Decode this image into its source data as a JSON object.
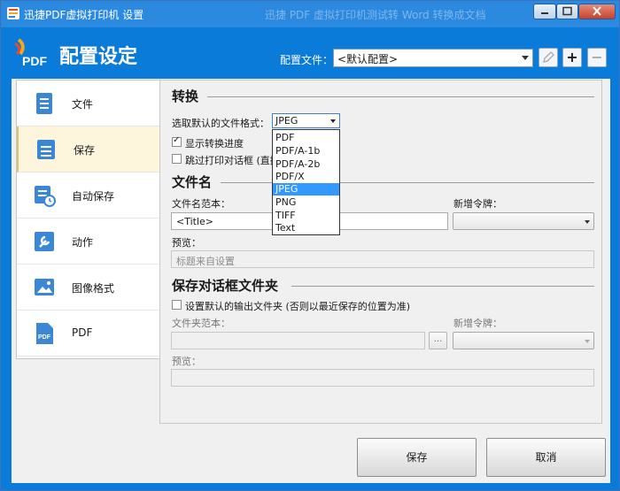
{
  "window": {
    "title": "迅捷PDF虚拟打印机 设置",
    "ghost_title": "迅捷 PDF 虚拟打印机测试转 Word 转换成文档",
    "colors": {
      "header": "#0a7bd8",
      "selection": "#3399ff",
      "nav_active": "#fdf5dc"
    }
  },
  "header": {
    "logo_text": "PDF",
    "title": "配置设定",
    "profile_label": "配置文件：",
    "profile_value": "<默认配置>",
    "icons": [
      "pencil-icon",
      "plus-icon",
      "minus-icon"
    ],
    "plus_glyph": "+",
    "minus_glyph": "−"
  },
  "nav": {
    "items": [
      {
        "label": "文件",
        "icon": "document-icon"
      },
      {
        "label": "保存",
        "icon": "save-list-icon"
      },
      {
        "label": "自动保存",
        "icon": "autosave-clock-icon"
      },
      {
        "label": "动作",
        "icon": "wrench-icon"
      },
      {
        "label": "图像格式",
        "icon": "image-icon"
      },
      {
        "label": "PDF",
        "icon": "pdf-file-icon"
      }
    ],
    "active_index": 1
  },
  "convert": {
    "heading": "转换",
    "format_label": "选取默认的文件格式：",
    "format_value": "JPEG",
    "show_progress_label": "显示转换进度",
    "show_progress_checked": true,
    "skip_dialog_label": "跳过打印对话框 (直接",
    "skip_dialog_checked": false,
    "format_options": [
      "PDF",
      "PDF/A-1b",
      "PDF/A-2b",
      "PDF/X",
      "JPEG",
      "PNG",
      "TIFF",
      "Text"
    ],
    "selected_option_index": 4
  },
  "filename": {
    "heading": "文件名",
    "template_label": "文件名范本：",
    "template_value": "<Title>",
    "token_label": "新增令牌：",
    "preview_label": "预览：",
    "preview_value": "标题来自设置"
  },
  "save_dialog": {
    "heading": "保存对话框文件夹",
    "default_folder_label": "设置默认的输出文件夹 (否则以最近保存的位置为准)",
    "default_folder_checked": false,
    "folder_template_label": "文件夹范本：",
    "browse_label": "...",
    "token_label": "新增令牌：",
    "preview_label": "预览："
  },
  "footer": {
    "save_label": "保存",
    "cancel_label": "取消"
  }
}
